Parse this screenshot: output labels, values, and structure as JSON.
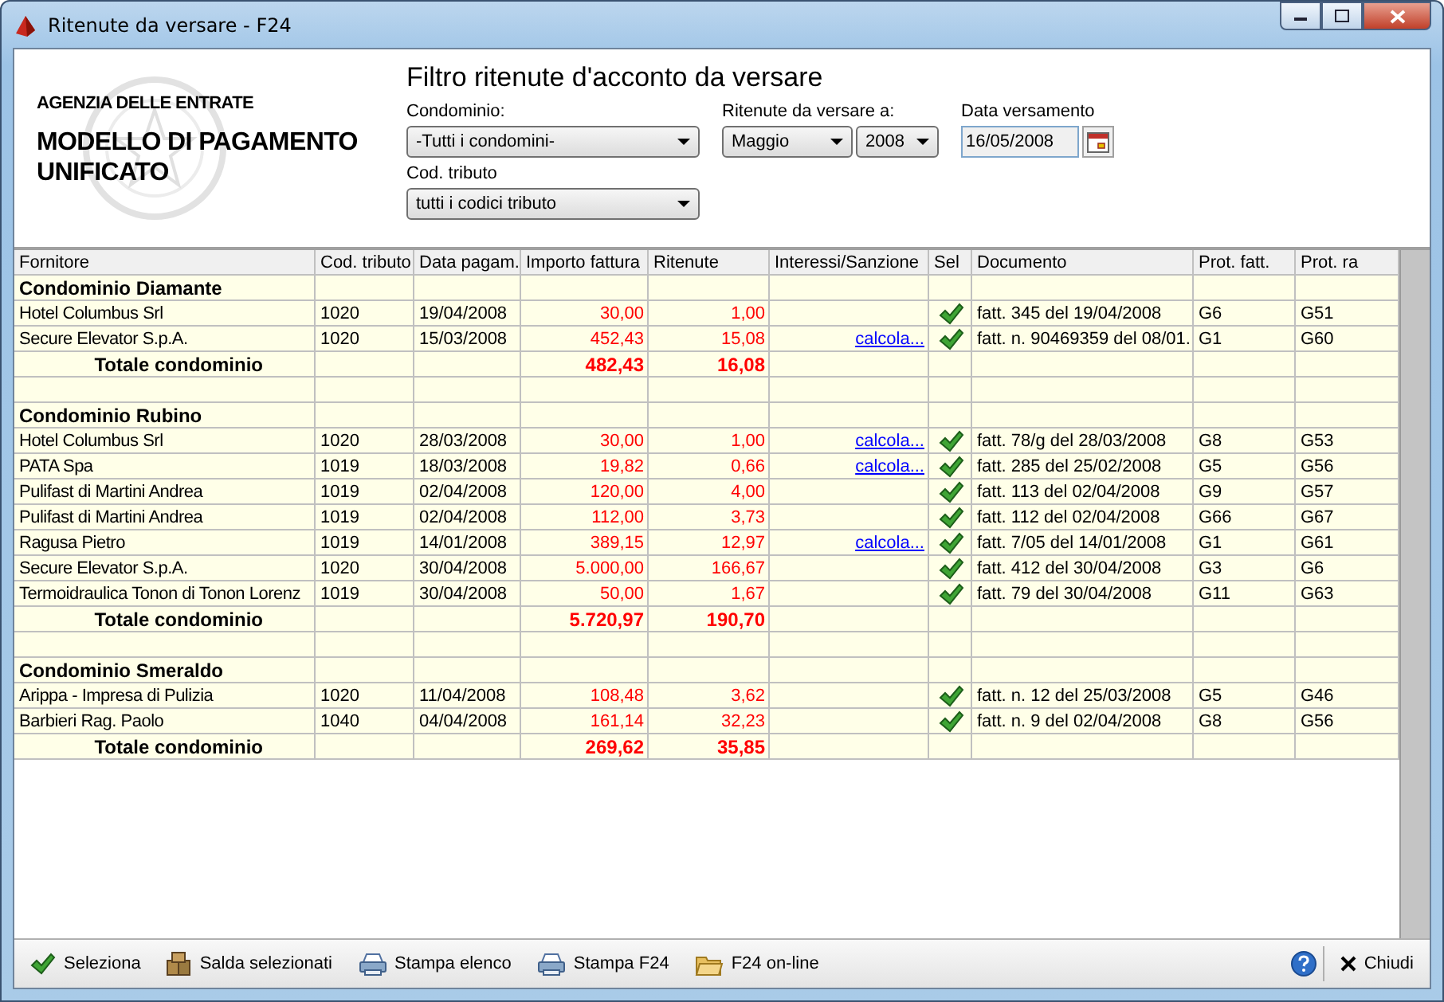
{
  "window": {
    "title": "Ritenute da versare - F24"
  },
  "logo": {
    "agency": "AGENZIA DELLE ENTRATE",
    "title": "MODELLO DI PAGAMENTO UNIFICATO"
  },
  "filter": {
    "title": "Filtro ritenute d'acconto da versare",
    "condominio": {
      "label": "Condominio:",
      "value": "-Tutti i condomini-"
    },
    "cod_tributo": {
      "label": "Cod. tributo",
      "value": "tutti i codici tributo"
    },
    "ritenute_a": {
      "label": "Ritenute da versare a:",
      "month": "Maggio",
      "year": "2008"
    },
    "data_versamento": {
      "label": "Data versamento",
      "value": "16/05/2008"
    }
  },
  "table": {
    "columns": [
      "Fornitore",
      "Cod. tributo",
      "Data pagam.",
      "Importo fattura",
      "Ritenute",
      "Interessi/Sanzione",
      "Sel",
      "Documento",
      "Prot. fatt.",
      "Prot. ra"
    ],
    "rows": [
      {
        "kind": "group",
        "label": "Condominio Diamante"
      },
      {
        "kind": "item",
        "fornitore": "Hotel Columbus Srl",
        "cod": "1020",
        "data": "19/04/2008",
        "importo": "30,00",
        "ritenute": "1,00",
        "checked": true,
        "documento": "fatt. 345 del 19/04/2008",
        "prot_fatt": "G6",
        "prot_ra": "G51"
      },
      {
        "kind": "item",
        "fornitore": "Secure Elevator S.p.A.",
        "cod": "1020",
        "data": "15/03/2008",
        "importo": "452,43",
        "ritenute": "15,08",
        "interessi": "calcola...",
        "checked": true,
        "documento": "fatt. n. 90469359 del 08/01.",
        "prot_fatt": "G1",
        "prot_ra": "G60"
      },
      {
        "kind": "total",
        "label": "Totale condominio",
        "importo": "482,43",
        "ritenute": "16,08"
      },
      {
        "kind": "blank"
      },
      {
        "kind": "group",
        "label": "Condominio Rubino"
      },
      {
        "kind": "item",
        "fornitore": "Hotel Columbus Srl",
        "cod": "1020",
        "data": "28/03/2008",
        "importo": "30,00",
        "ritenute": "1,00",
        "interessi": "calcola...",
        "checked": true,
        "documento": "fatt. 78/g del 28/03/2008",
        "prot_fatt": "G8",
        "prot_ra": "G53"
      },
      {
        "kind": "item",
        "fornitore": "PATA Spa",
        "cod": "1019",
        "data": "18/03/2008",
        "importo": "19,82",
        "ritenute": "0,66",
        "interessi": "calcola...",
        "checked": true,
        "documento": "fatt. 285 del 25/02/2008",
        "prot_fatt": "G5",
        "prot_ra": "G56"
      },
      {
        "kind": "item",
        "fornitore": "Pulifast di Martini Andrea",
        "cod": "1019",
        "data": "02/04/2008",
        "importo": "120,00",
        "ritenute": "4,00",
        "checked": true,
        "documento": "fatt. 113 del 02/04/2008",
        "prot_fatt": "G9",
        "prot_ra": "G57"
      },
      {
        "kind": "item",
        "fornitore": "Pulifast di Martini Andrea",
        "cod": "1019",
        "data": "02/04/2008",
        "importo": "112,00",
        "ritenute": "3,73",
        "checked": true,
        "documento": "fatt. 112 del 02/04/2008",
        "prot_fatt": "G66",
        "prot_ra": "G67"
      },
      {
        "kind": "item",
        "fornitore": "Ragusa Pietro",
        "cod": "1019",
        "data": "14/01/2008",
        "importo": "389,15",
        "ritenute": "12,97",
        "interessi": "calcola...",
        "checked": true,
        "documento": "fatt. 7/05 del 14/01/2008",
        "prot_fatt": "G1",
        "prot_ra": "G61"
      },
      {
        "kind": "item",
        "fornitore": "Secure Elevator S.p.A.",
        "cod": "1020",
        "data": "30/04/2008",
        "importo": "5.000,00",
        "ritenute": "166,67",
        "checked": true,
        "documento": "fatt. 412 del 30/04/2008",
        "prot_fatt": "G3",
        "prot_ra": "G6"
      },
      {
        "kind": "item",
        "fornitore": "Termoidraulica Tonon di Tonon Lorenz",
        "cod": "1019",
        "data": "30/04/2008",
        "importo": "50,00",
        "ritenute": "1,67",
        "checked": true,
        "documento": "fatt. 79 del 30/04/2008",
        "prot_fatt": "G11",
        "prot_ra": "G63"
      },
      {
        "kind": "total",
        "label": "Totale condominio",
        "importo": "5.720,97",
        "ritenute": "190,70"
      },
      {
        "kind": "blank"
      },
      {
        "kind": "group",
        "label": "Condominio Smeraldo"
      },
      {
        "kind": "item",
        "fornitore": "Arippa - Impresa di Pulizia",
        "cod": "1020",
        "data": "11/04/2008",
        "importo": "108,48",
        "ritenute": "3,62",
        "checked": true,
        "documento": "fatt. n. 12 del 25/03/2008",
        "prot_fatt": "G5",
        "prot_ra": "G46"
      },
      {
        "kind": "item",
        "fornitore": "Barbieri Rag. Paolo",
        "cod": "1040",
        "data": "04/04/2008",
        "importo": "161,14",
        "ritenute": "32,23",
        "checked": true,
        "documento": "fatt. n. 9 del 02/04/2008",
        "prot_fatt": "G8",
        "prot_ra": "G56"
      },
      {
        "kind": "total",
        "label": "Totale condominio",
        "importo": "269,62",
        "ritenute": "35,85"
      }
    ]
  },
  "toolbar": {
    "left": [
      {
        "kind": "check",
        "label": "Seleziona"
      },
      {
        "kind": "boxes",
        "label": "Salda selezionati"
      },
      {
        "kind": "printer",
        "label": "Stampa elenco"
      },
      {
        "kind": "printer",
        "label": "Stampa F24"
      },
      {
        "kind": "folder",
        "label": "F24 on-line"
      }
    ],
    "close": {
      "label": "Chiudi"
    }
  }
}
